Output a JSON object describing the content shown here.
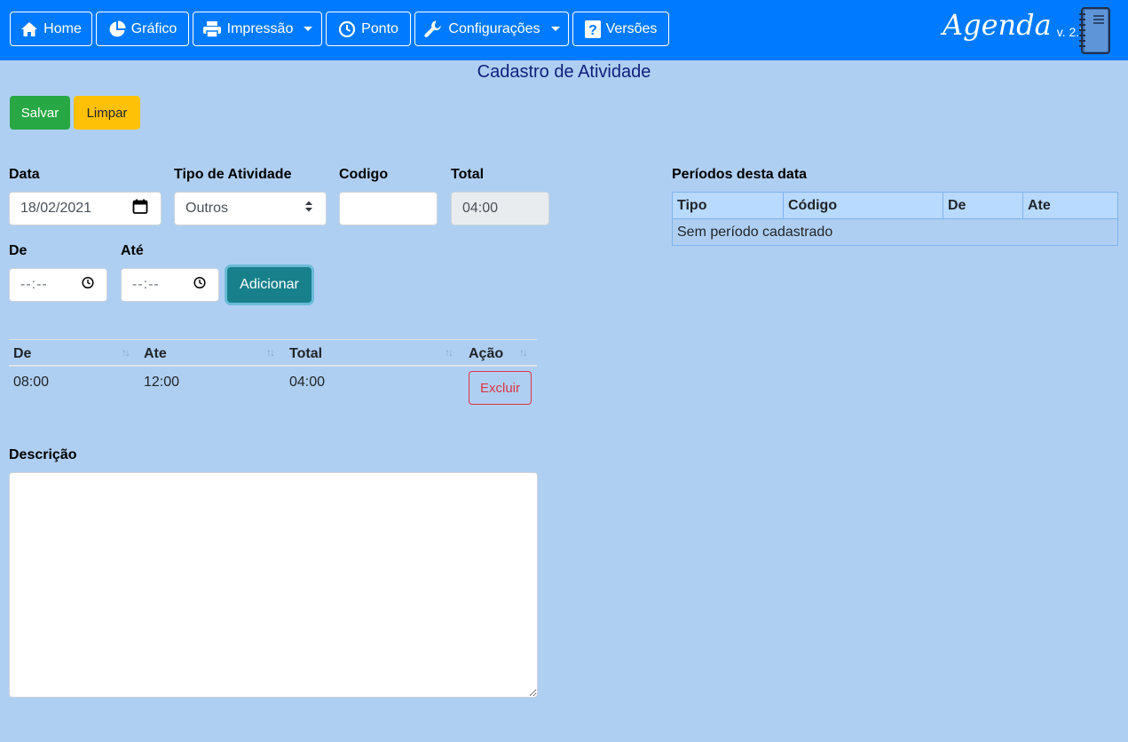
{
  "nav": {
    "items": [
      {
        "label": "Home",
        "icon": "home-icon"
      },
      {
        "label": "Gráfico",
        "icon": "pie-chart-icon"
      },
      {
        "label": "Impressão",
        "icon": "printer-icon",
        "dropdown": true
      },
      {
        "label": "Ponto",
        "icon": "clock-icon"
      },
      {
        "label": "Configurações",
        "icon": "wrench-icon",
        "dropdown": true
      },
      {
        "label": "Versões",
        "icon": "question-icon"
      }
    ],
    "brand": "Agenda",
    "version": "v. 2.7"
  },
  "page_title": "Cadastro de Atividade",
  "actions": {
    "save_label": "Salvar",
    "clear_label": "Limpar"
  },
  "form": {
    "date_label": "Data",
    "date_value": "18/02/2021",
    "type_label": "Tipo de Atividade",
    "type_value": "Outros",
    "code_label": "Codigo",
    "code_value": "",
    "total_label": "Total",
    "total_value": "04:00",
    "from_label": "De",
    "from_value": "--:--",
    "to_label": "Até",
    "to_value": "--:--",
    "add_label": "Adicionar"
  },
  "intervals": {
    "headers": [
      "De",
      "Ate",
      "Total",
      "Ação"
    ],
    "rows": [
      {
        "from": "08:00",
        "to": "12:00",
        "total": "04:00",
        "action": "Excluir"
      }
    ]
  },
  "description_label": "Descrição",
  "periods": {
    "title": "Períodos desta data",
    "headers": [
      "Tipo",
      "Código",
      "De",
      "Ate"
    ],
    "empty_text": "Sem período cadastrado"
  },
  "colors": {
    "navbar": "#007bff",
    "page_bg": "#afcff2",
    "success": "#28a745",
    "warning": "#ffc107",
    "info": "#17808b",
    "danger": "#dc3545"
  }
}
